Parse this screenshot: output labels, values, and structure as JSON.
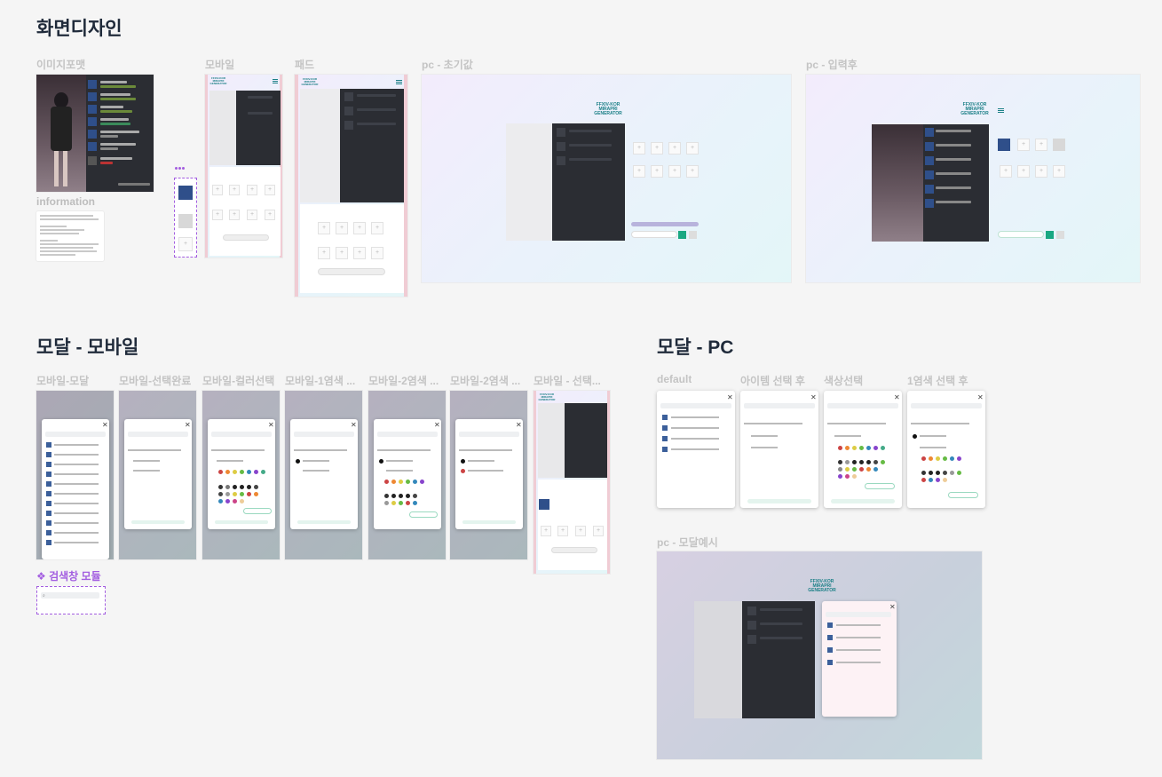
{
  "section1": {
    "title": "화면디자인",
    "labels": {
      "image_format": "이미지포맷",
      "mobile": "모바일",
      "pad": "패드",
      "pc_initial": "pc - 초기값",
      "pc_after_input": "pc - 입력후",
      "information": "information"
    },
    "logo_text": "FFXIV-KOR\nMIRAPRI\nGENERATOR"
  },
  "section2": {
    "title": "모달 - 모바일",
    "labels": [
      "모바일-모달",
      "모바일-선택완료",
      "모바일-컬러선택",
      "모바일-1염색 ...",
      "모바일-2염색 ...",
      "모바일-2염색 ...",
      "모바일 - 선택..."
    ],
    "search_module_title": "❖ 검색창 모듈"
  },
  "section3": {
    "title": "모달 - PC",
    "labels": [
      "default",
      "아이템 선택 후",
      "색상선택",
      "1염색 선택 후"
    ],
    "pc_modal_example_label": "pc - 모달예시"
  },
  "colors": {
    "accent_teal": "#1a7f86",
    "dark_panel": "#2b2d33",
    "pink_stripe": "#f0ccd4",
    "purple_module": "#a35ee0"
  }
}
